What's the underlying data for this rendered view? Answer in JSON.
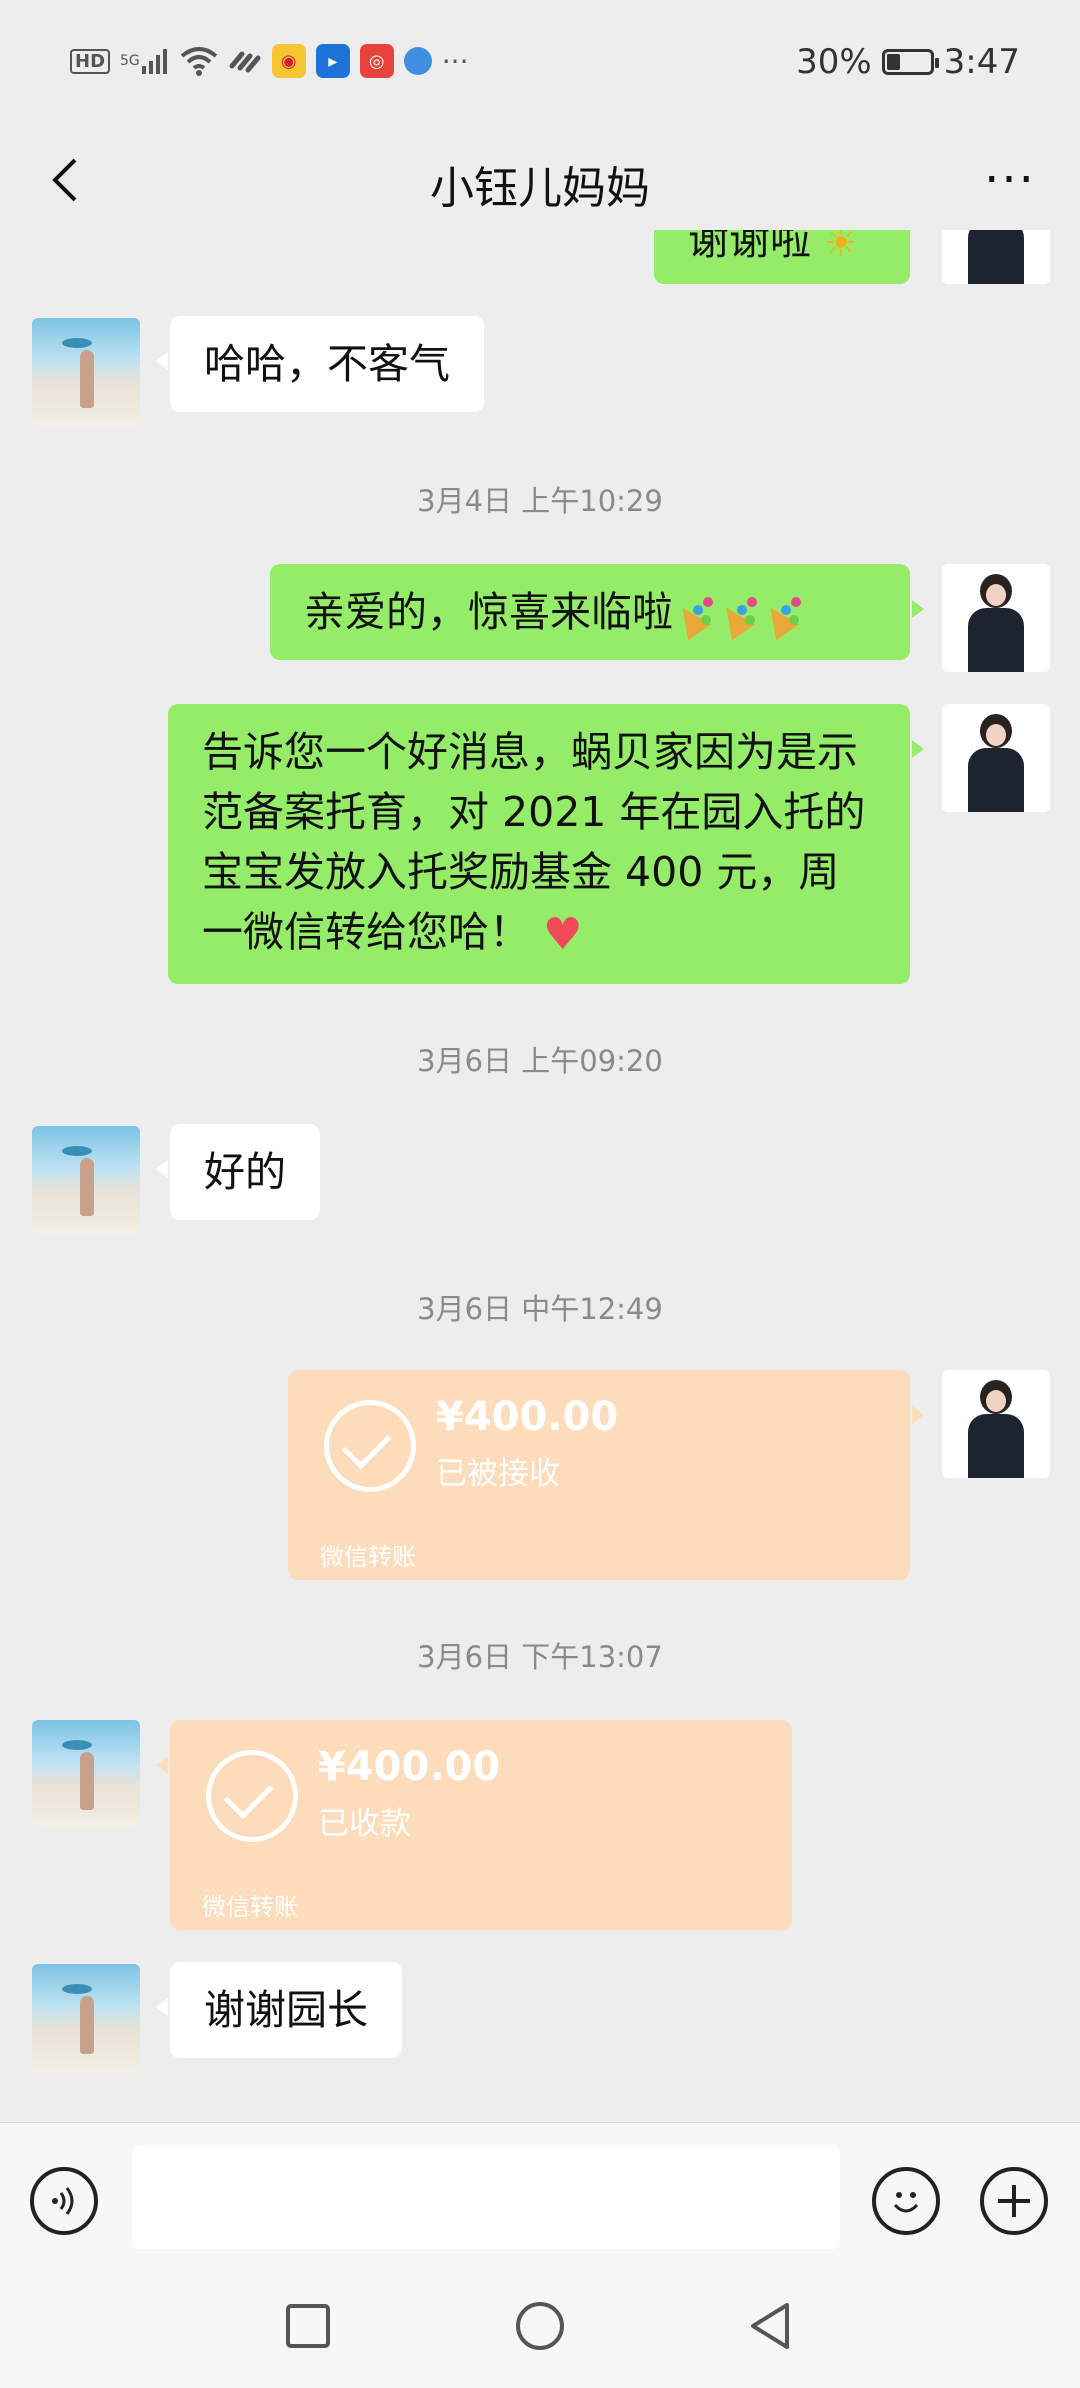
{
  "status_bar": {
    "hd": "HD",
    "network": "5G",
    "battery_percent": "30%",
    "battery_level": 0.3,
    "time": "3:47",
    "overflow": "···",
    "icons": [
      "hd-icon",
      "signal-icon",
      "wifi-icon",
      "link-icon",
      "weibo-icon",
      "app-blue-icon",
      "app-red-icon",
      "app-globe-icon",
      "more-icon"
    ]
  },
  "header": {
    "title": "小钰儿妈妈",
    "back_icon": "chevron-left-icon",
    "more_label": "···"
  },
  "messages": {
    "m0": {
      "text": "谢谢啦",
      "side": "out"
    },
    "m1": {
      "text": "哈哈，不客气",
      "side": "in"
    },
    "ts1": "3月4日 上午10:29",
    "m2": {
      "text": "亲爱的，惊喜来临啦",
      "side": "out"
    },
    "m3": {
      "text": "告诉您一个好消息，蜗贝家因为是示范备案托育，对 2021 年在园入托的宝宝发放入托奖励基金 400 元，周一微信转给您哈！",
      "side": "out"
    },
    "ts2": "3月6日 上午09:20",
    "m4": {
      "text": "好的",
      "side": "in"
    },
    "ts3": "3月6日 中午12:49",
    "t1": {
      "amount": "¥400.00",
      "status": "已被接收",
      "label": "微信转账",
      "side": "out"
    },
    "ts4": "3月6日 下午13:07",
    "t2": {
      "amount": "¥400.00",
      "status": "已收款",
      "label": "微信转账",
      "side": "in"
    },
    "m5": {
      "text": "谢谢园长",
      "side": "in"
    }
  },
  "input_bar": {
    "voice_icon": "voice-icon",
    "emoji_icon": "emoji-icon",
    "plus_icon": "plus-icon"
  },
  "nav_bar": {
    "icons": [
      "recent-apps-icon",
      "home-icon",
      "back-icon"
    ]
  },
  "colors": {
    "background": "#ededed",
    "bubble_out": "#95ec69",
    "bubble_in": "#ffffff",
    "transfer": "#fcdcbb",
    "timestamp": "#8a8a8a"
  }
}
